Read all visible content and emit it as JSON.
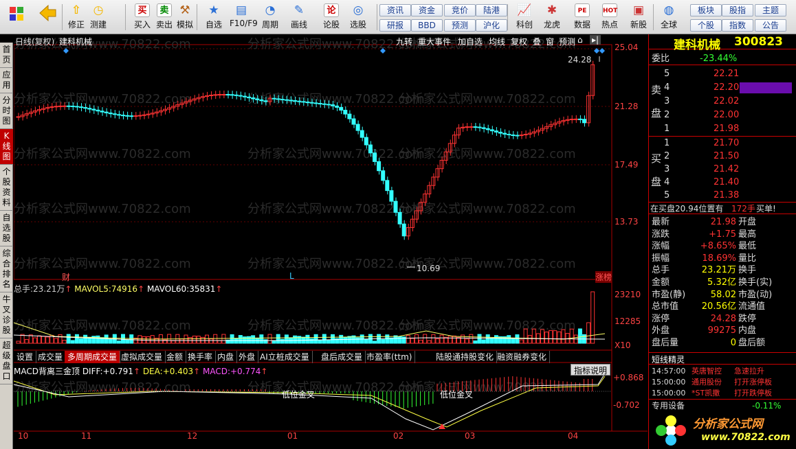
{
  "toolbar": {
    "icons": [
      {
        "name": "windows-logo-icon"
      },
      {
        "name": "back-arrow-icon"
      }
    ],
    "buttons": [
      {
        "name": "modify",
        "label": "修正",
        "icon": "arrow-up-icon"
      },
      {
        "name": "test",
        "label": "测建",
        "icon": "clock-icon"
      },
      {
        "name": "buy",
        "label": "买入",
        "glyph": "买"
      },
      {
        "name": "sell",
        "label": "卖出",
        "glyph": "卖"
      },
      {
        "name": "simulate",
        "label": "模拟",
        "icon": "hammer-icon"
      },
      {
        "name": "watchlist",
        "label": "自选",
        "icon": "star-icon"
      },
      {
        "name": "f10",
        "label": "F10/F9",
        "icon": "window-icon"
      },
      {
        "name": "period",
        "label": "周期",
        "icon": "period-icon"
      },
      {
        "name": "draw",
        "label": "画线",
        "icon": "pencil-icon"
      },
      {
        "name": "discuss",
        "label": "论股",
        "glyph": "论"
      },
      {
        "name": "pick",
        "label": "选股",
        "icon": "target-icon"
      },
      {
        "name": "kechuang",
        "label": "科创",
        "icon": "chart-icon"
      },
      {
        "name": "dragon",
        "label": "龙虎",
        "icon": "dragon-icon"
      },
      {
        "name": "data",
        "label": "数据",
        "glyph": "PE"
      },
      {
        "name": "hot",
        "label": "热点",
        "glyph": "HOT"
      },
      {
        "name": "newstock",
        "label": "新股",
        "icon": "gift-icon"
      },
      {
        "name": "global",
        "label": "全球",
        "icon": "globe-icon"
      }
    ],
    "small": [
      "资讯",
      "资金",
      "竞价",
      "陆港",
      "研报",
      "BBD",
      "预测",
      "沪化"
    ],
    "small2": [
      "板块",
      "股指",
      "主题",
      "个股",
      "指数",
      "公告"
    ]
  },
  "lefttabs": [
    "首页",
    "应用",
    "分时图",
    "K线图",
    "个股资料",
    "自选股",
    "综合排名",
    "牛叉诊股",
    "超级盘口"
  ],
  "chart": {
    "title": "日线(复权)",
    "stock": "建科机械",
    "top_buttons": [
      "九转",
      "重大事件",
      "加自选",
      "均线",
      "复权",
      "叠",
      "窗",
      "预测"
    ],
    "price_axis": [
      "25.04",
      "21.28",
      "17.49",
      "13.73"
    ],
    "high_label": "24.28",
    "low_label": "10.69",
    "markers": [
      "财",
      "L",
      "涨榜"
    ],
    "vol": {
      "title": "总手:",
      "total": "23.21万",
      "mavol5_label": "MAVOL5:",
      "mavol5": "74916",
      "mavol60_label": "MAVOL60:",
      "mavol60": "35831",
      "axis": [
        "23210",
        "12285",
        "X10"
      ]
    },
    "tabs": [
      "设置",
      "成交量",
      "多周期成交量",
      "虚拟成交量",
      "金额",
      "换手率",
      "内盘",
      "外盘",
      "AI立桩成交量",
      "盘后成交量",
      "市盈率(ttm)",
      "陆股通持股变化",
      "融资融券变化"
    ],
    "macd": {
      "title": "MACD背离三金顶",
      "diff_label": "DIFF:",
      "diff": "+0.791",
      "dea_label": "DEA:",
      "dea": "+0.403",
      "macd_label": "MACD:",
      "macd": "+0.774",
      "axis": [
        "+0.868",
        "-0.702"
      ],
      "cross1": "低位金叉",
      "cross2": "低位金叉",
      "help": "指标说明"
    },
    "dates": [
      "10",
      "11",
      "12",
      "01",
      "02",
      "03",
      "04"
    ],
    "watermark": "分析家公式网www.70822.com"
  },
  "right": {
    "stock_name": "建科机械",
    "code": "300823",
    "webi_label": "委比",
    "webi": "-23.44%",
    "sell_label": [
      "卖",
      "盘"
    ],
    "buy_label": [
      "买",
      "盘"
    ],
    "asks": [
      {
        "n": "5",
        "p": "22.21"
      },
      {
        "n": "4",
        "p": "22.20"
      },
      {
        "n": "3",
        "p": "22.02"
      },
      {
        "n": "2",
        "p": "22.00"
      },
      {
        "n": "1",
        "p": "21.98"
      }
    ],
    "bids": [
      {
        "n": "1",
        "p": "21.70"
      },
      {
        "n": "2",
        "p": "21.50"
      },
      {
        "n": "3",
        "p": "21.42"
      },
      {
        "n": "4",
        "p": "21.40"
      },
      {
        "n": "5",
        "p": "21.38"
      }
    ],
    "buy_notice": {
      "text": "在买盘20.94位置有",
      "hand": "172手",
      "tag": "买单!"
    },
    "stats": [
      [
        "最新",
        "21.98",
        "开盘",
        ""
      ],
      [
        "涨跌",
        "+1.75",
        "最高",
        ""
      ],
      [
        "涨幅",
        "+8.65%",
        "最低",
        ""
      ],
      [
        "振幅",
        "18.69%",
        "量比",
        ""
      ],
      [
        "总手",
        "23.21万",
        "换手",
        ""
      ],
      [
        "金额",
        "5.32亿",
        "换手(实)",
        ""
      ],
      [
        "市盈(静)",
        "58.02",
        "市盈(动)",
        ""
      ],
      [
        "总市值",
        "20.56亿",
        "流通值",
        ""
      ],
      [
        "涨停",
        "24.28",
        "跌停",
        ""
      ],
      [
        "外盘",
        "99275",
        "内盘",
        ""
      ],
      [
        "盘后量",
        "0",
        "盘后额",
        ""
      ]
    ],
    "news_title": "短线精灵",
    "news": [
      [
        "14:57:00",
        "英唐智控",
        "急速拉升"
      ],
      [
        "15:00:00",
        "通用股份",
        "打开涨停板"
      ],
      [
        "15:00:00",
        "*ST凯撒",
        "打开跌停板"
      ]
    ],
    "sector_label": "专用设备",
    "sector_chg": "-0.11%",
    "logo_text": "分析家公式网",
    "logo_url": "www.70822.com"
  }
}
